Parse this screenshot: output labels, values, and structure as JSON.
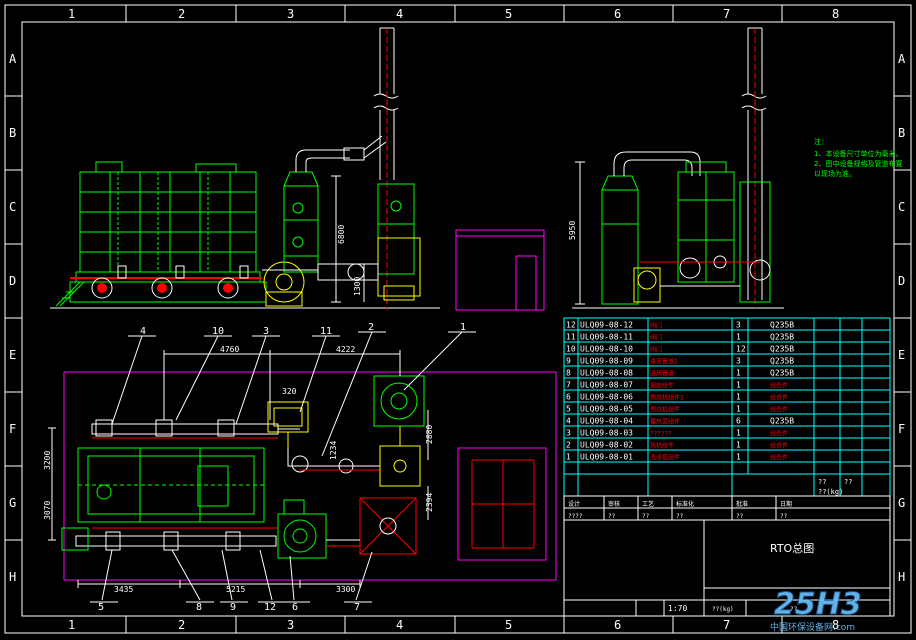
{
  "frame": {
    "columns": [
      "1",
      "2",
      "3",
      "4",
      "5",
      "6",
      "7",
      "8"
    ],
    "rows": [
      "A",
      "B",
      "C",
      "D",
      "E",
      "F",
      "G",
      "H"
    ]
  },
  "dimensions": {
    "elev_left_6800": "6800",
    "elev_left_1300": "1300",
    "elev_right_5950": "5950",
    "plan_4760": "4760",
    "plan_4222": "4222",
    "plan_3200": "3200",
    "plan_3070": "3070",
    "plan_3435": "3435",
    "plan_5215": "5215",
    "plan_3300": "3300",
    "plan_2880": "2880",
    "plan_1234": "1234",
    "plan_320": "320",
    "plan_2394": "2394"
  },
  "balloons_top": [
    "4",
    "10",
    "3",
    "11",
    "2",
    "1"
  ],
  "balloons_bottom": [
    "5",
    "8",
    "9",
    "12",
    "6",
    "7"
  ],
  "notes": {
    "title": "注：",
    "line1": "1、本设备尺寸单位为毫米。",
    "line2": "2、图中设备规格及管道布置",
    "line3": "以现场为准。"
  },
  "bom": [
    {
      "no": "12",
      "code": "ULQ09-08-12",
      "name": "阀门",
      "qty": "3",
      "mat": "Q235B"
    },
    {
      "no": "11",
      "code": "ULQ09-08-11",
      "name": "阀门",
      "qty": "1",
      "mat": "Q235B"
    },
    {
      "no": "10",
      "code": "ULQ09-08-10",
      "name": "阀门",
      "qty": "12",
      "mat": "Q235B"
    },
    {
      "no": "9",
      "code": "ULQ09-08-09",
      "name": "进风管道2",
      "qty": "3",
      "mat": "Q235B"
    },
    {
      "no": "8",
      "code": "ULQ09-08-08",
      "name": "进风管道",
      "qty": "1",
      "mat": "Q235B"
    },
    {
      "no": "7",
      "code": "ULQ09-08-07",
      "name": "烟囱组件",
      "qty": "1",
      "mat": "组合件"
    },
    {
      "no": "6",
      "code": "ULQ09-08-06",
      "name": "燃烧机组件2",
      "qty": "1",
      "mat": "组合件"
    },
    {
      "no": "5",
      "code": "ULQ09-08-05",
      "name": "燃烧机组件",
      "qty": "1",
      "mat": "组合件"
    },
    {
      "no": "4",
      "code": "ULQ09-08-04",
      "name": "蓄热室组件",
      "qty": "6",
      "mat": "Q235B"
    },
    {
      "no": "3",
      "code": "ULQ09-08-03",
      "name": "??????",
      "qty": "1",
      "mat": "组合件"
    },
    {
      "no": "2",
      "code": "ULQ09-08-02",
      "name": "风机组件",
      "qty": "1",
      "mat": "组合件"
    },
    {
      "no": "1",
      "code": "ULQ09-08-01",
      "name": "洗涤塔组件",
      "qty": "1",
      "mat": "组合件"
    }
  ],
  "bom_footer": {
    "a": "??",
    "b": "??",
    "weight": "??(kg)"
  },
  "title_block": {
    "labels": [
      "设计",
      "审核",
      "工艺",
      "标准化",
      "批准",
      "日期"
    ],
    "values": [
      "????",
      "??",
      "??",
      "??",
      "??",
      "??"
    ],
    "drawing_name": "RTO总图",
    "scale": "1:70",
    "weight": "??(kg)",
    "sheet": "??"
  },
  "watermark": {
    "logo": "25H3",
    "site": "中国环保设备网.com"
  },
  "colors": {
    "frame": "#ffffff",
    "equipment": "#00ff00",
    "duct": "#ff0000",
    "fan": "#ffff00",
    "building": "#ff00ff",
    "dimension": "#ffffff",
    "table": "#00ffff",
    "bom_text": "#ff0000"
  }
}
